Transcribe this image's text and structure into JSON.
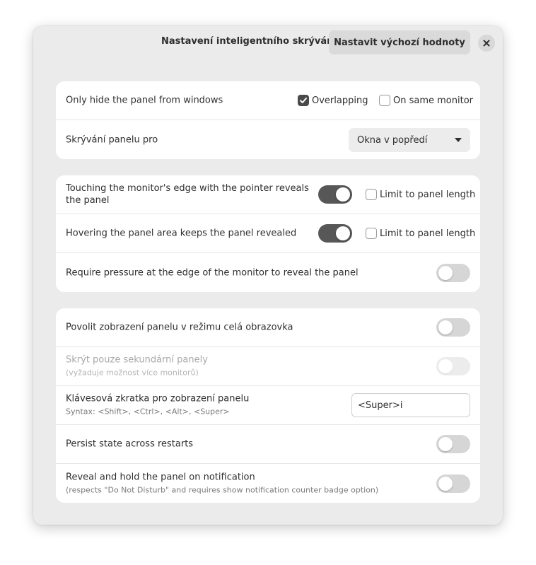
{
  "header": {
    "title": "Nastavení inteligentního skrývání",
    "reset_label": "Nastavit výchozí hodnoty",
    "close_icon": "close-icon"
  },
  "group1": {
    "windows_row": {
      "label": "Only hide the panel from windows",
      "overlapping": {
        "label": "Overlapping",
        "checked": true
      },
      "same_monitor": {
        "label": "On same monitor",
        "checked": false
      }
    },
    "hide_for_row": {
      "label": "Skrývání panelu pro",
      "selected": "Okna v popředí"
    }
  },
  "group2": {
    "edge_reveal": {
      "label": "Touching the monitor's edge with the pointer reveals the panel",
      "enabled": true,
      "limit_label": "Limit to panel length",
      "limit_checked": false
    },
    "hover_keep": {
      "label": "Hovering the panel area keeps the panel revealed",
      "enabled": true,
      "limit_label": "Limit to panel length",
      "limit_checked": false
    },
    "pressure": {
      "label": "Require pressure at the edge of the monitor to reveal the panel",
      "enabled": false
    }
  },
  "group3": {
    "fullscreen": {
      "label": "Povolit zobrazení panelu v režimu celá obrazovka",
      "enabled": false
    },
    "secondary": {
      "label": "Skrýt pouze sekundární panely",
      "sublabel": "(vyžaduje možnost více monitorů)",
      "enabled": false,
      "disabled": true
    },
    "shortcut": {
      "label": "Klávesová zkratka pro zobrazení panelu",
      "sublabel": "Syntax: <Shift>, <Ctrl>, <Alt>, <Super>",
      "value": "<Super>i"
    },
    "persist": {
      "label": "Persist state across restarts",
      "enabled": false
    },
    "notification": {
      "label": "Reveal and hold the panel on notification",
      "sublabel": "(respects \"Do Not Disturb\" and requires show notification counter badge option)",
      "enabled": false
    }
  },
  "colors": {
    "accent": "#575757",
    "toggle_off": "#d6d6d6",
    "dialog_bg": "#ebebeb"
  }
}
